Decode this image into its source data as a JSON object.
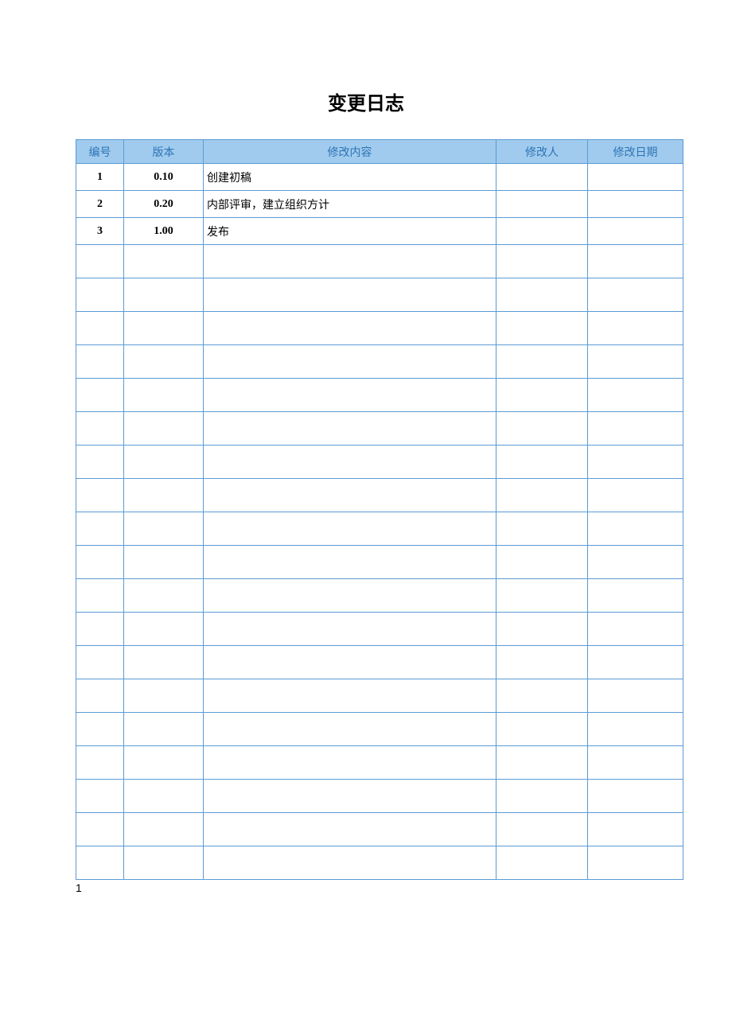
{
  "title": "变更日志",
  "headers": {
    "idx": "编号",
    "ver": "版本",
    "desc": "修改内容",
    "who": "修改人",
    "date": "修改日期"
  },
  "rows": [
    {
      "idx": "1",
      "ver": "0.10",
      "desc": "创建初稿",
      "who": "",
      "date": ""
    },
    {
      "idx": "2",
      "ver": "0.20",
      "desc": "内部评审，建立组织方计",
      "who": "",
      "date": ""
    },
    {
      "idx": "3",
      "ver": "1.00",
      "desc": "发布",
      "who": "",
      "date": ""
    },
    {
      "idx": "",
      "ver": "",
      "desc": "",
      "who": "",
      "date": ""
    },
    {
      "idx": "",
      "ver": "",
      "desc": "",
      "who": "",
      "date": ""
    },
    {
      "idx": "",
      "ver": "",
      "desc": "",
      "who": "",
      "date": ""
    },
    {
      "idx": "",
      "ver": "",
      "desc": "",
      "who": "",
      "date": ""
    },
    {
      "idx": "",
      "ver": "",
      "desc": "",
      "who": "",
      "date": ""
    },
    {
      "idx": "",
      "ver": "",
      "desc": "",
      "who": "",
      "date": ""
    },
    {
      "idx": "",
      "ver": "",
      "desc": "",
      "who": "",
      "date": ""
    },
    {
      "idx": "",
      "ver": "",
      "desc": "",
      "who": "",
      "date": ""
    },
    {
      "idx": "",
      "ver": "",
      "desc": "",
      "who": "",
      "date": ""
    },
    {
      "idx": "",
      "ver": "",
      "desc": "",
      "who": "",
      "date": ""
    },
    {
      "idx": "",
      "ver": "",
      "desc": "",
      "who": "",
      "date": ""
    },
    {
      "idx": "",
      "ver": "",
      "desc": "",
      "who": "",
      "date": ""
    },
    {
      "idx": "",
      "ver": "",
      "desc": "",
      "who": "",
      "date": ""
    },
    {
      "idx": "",
      "ver": "",
      "desc": "",
      "who": "",
      "date": ""
    },
    {
      "idx": "",
      "ver": "",
      "desc": "",
      "who": "",
      "date": ""
    },
    {
      "idx": "",
      "ver": "",
      "desc": "",
      "who": "",
      "date": ""
    },
    {
      "idx": "",
      "ver": "",
      "desc": "",
      "who": "",
      "date": ""
    },
    {
      "idx": "",
      "ver": "",
      "desc": "",
      "who": "",
      "date": ""
    },
    {
      "idx": "",
      "ver": "",
      "desc": "",
      "who": "",
      "date": ""
    }
  ],
  "footnote": "1"
}
